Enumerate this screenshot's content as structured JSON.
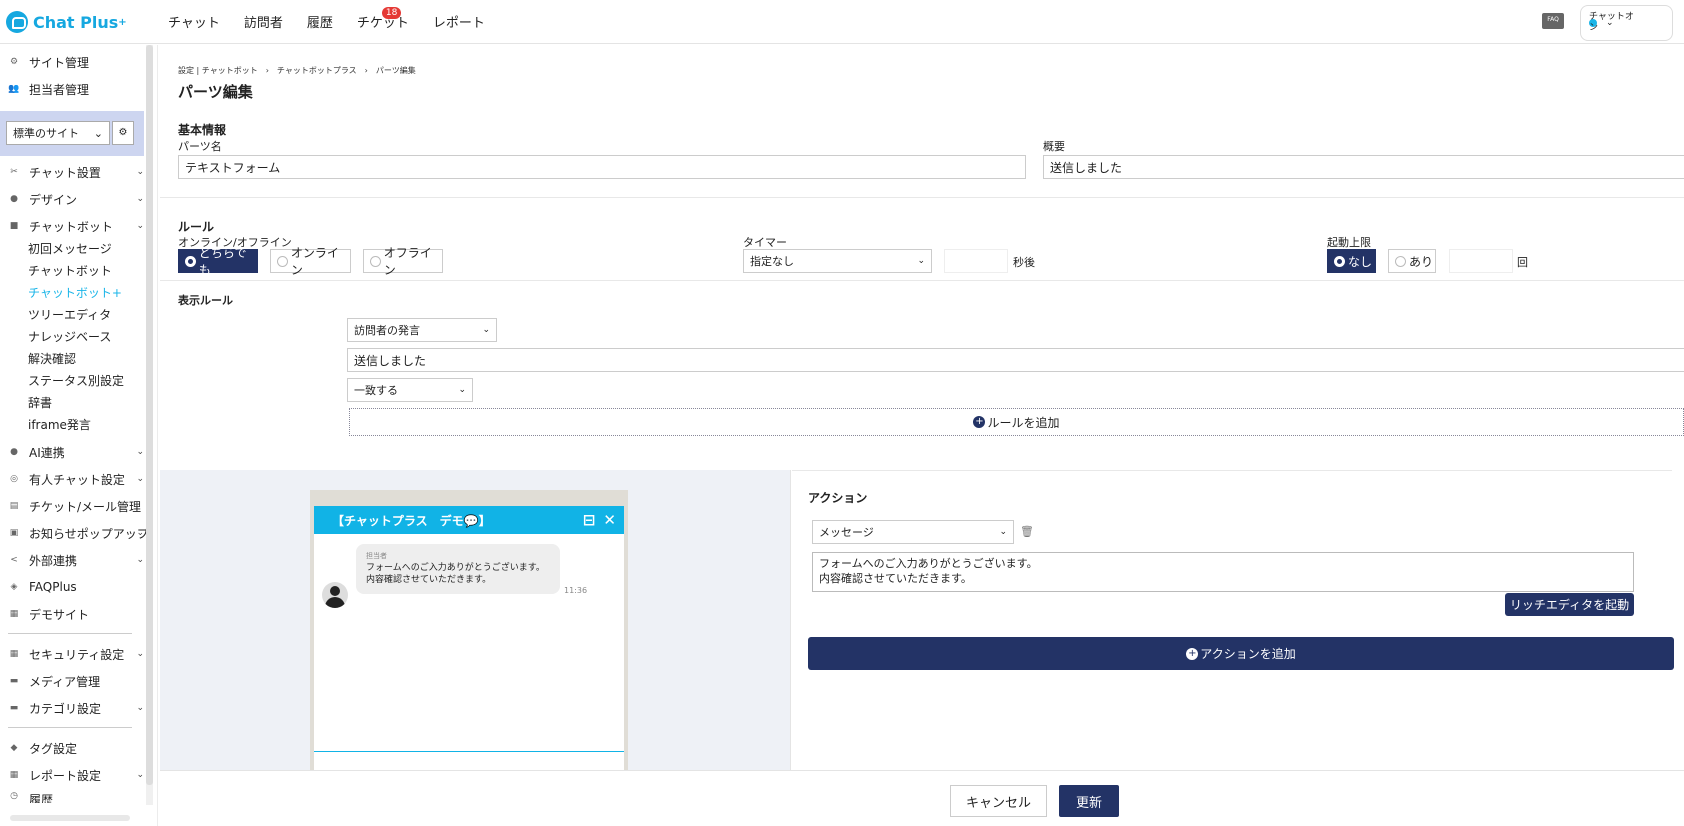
{
  "header": {
    "logo_text": "Chat Plus",
    "logo_sup": "+",
    "nav": [
      "チャット",
      "訪問者",
      "履歴",
      "チケット",
      "レポート"
    ],
    "ticket_badge": "18",
    "faq_label": "FAQ",
    "status_label": "チャットオン",
    "status_color": "#1ab5e8"
  },
  "sidebar": {
    "top_items": [
      "サイト管理",
      "担当者管理"
    ],
    "site_select": "標準のサイト",
    "items_a": [
      "チャット設置",
      "デザイン",
      "チャットボット"
    ],
    "chatbot_sub": [
      "初回メッセージ",
      "チャットボット",
      "チャットボット+",
      "ツリーエディタ",
      "ナレッジベース",
      "解決確認",
      "ステータス別設定",
      "辞書",
      "iframe発言"
    ],
    "items_b": [
      "AI連携",
      "有人チャット設定",
      "チケット/メール管理",
      "お知らせポップアップ",
      "外部連携",
      "FAQPlus",
      "デモサイト"
    ],
    "items_c": [
      "セキュリティ設定",
      "メディア管理",
      "カテゴリ設定"
    ],
    "items_d": [
      "タグ設定",
      "レポート設定",
      "履歴"
    ]
  },
  "page": {
    "breadcrumb": "設定 | チャットボット　›　チャットボットプラス　›　パーツ編集",
    "title": "パーツ編集",
    "basic": {
      "heading": "基本情報",
      "name_label": "パーツ名",
      "name_value": "テキストフォーム",
      "summary_label": "概要",
      "summary_value": "送信しました"
    },
    "rule": {
      "heading": "ルール",
      "online_label": "オンライン/オフライン",
      "online_options": [
        "どちらでも",
        "オンライン",
        "オフライン"
      ],
      "timer_label": "タイマー",
      "timer_value": "指定なし",
      "timer_unit": "秒後",
      "limit_label": "起動上限",
      "limit_options": [
        "なし",
        "あり"
      ],
      "limit_unit": "回"
    },
    "display_rule": {
      "heading": "表示ルール",
      "type": "訪問者の発言",
      "text": "送信しました",
      "match": "一致する",
      "add_label": "ルールを追加"
    },
    "preview": {
      "title": "【チャットプラス　デモ💬】",
      "agent": "担当者",
      "message_line1": "フォームへのご入力ありがとうございます。",
      "message_line2": "内容確認させていただきます。",
      "time": "11:36"
    },
    "action": {
      "heading": "アクション",
      "type": "メッセージ",
      "text_line1": "フォームへのご入力ありがとうございます。",
      "text_line2": "内容確認させていただきます。",
      "rich_label": "リッチエディタを起動",
      "add_label": "アクションを追加"
    },
    "footer": {
      "cancel": "キャンセル",
      "update": "更新"
    },
    "colors": {
      "primary": "#233366",
      "accent": "#11b3e6"
    }
  }
}
